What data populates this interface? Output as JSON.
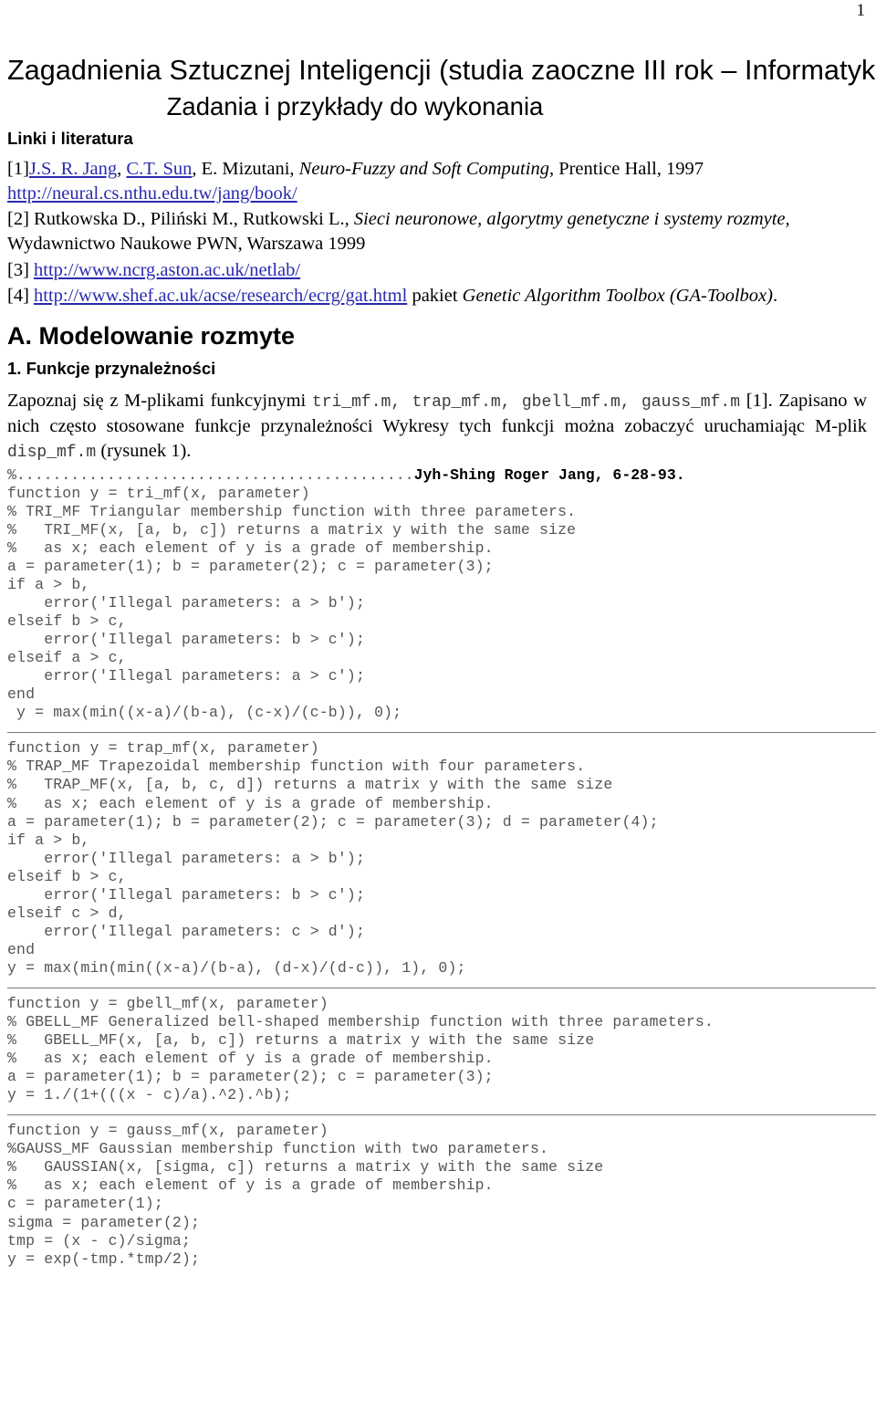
{
  "page": {
    "number": "1",
    "title": "Zagadnienia Sztucznej Inteligencji (studia zaoczne III rok – Informatyka)",
    "subtitle": "Zadania i przykłady do wykonania"
  },
  "links_section": {
    "heading": "Linki i literatura",
    "references": [
      {
        "marker": "[1]",
        "link1": "J.S. R. Jang",
        "sep1": ", ",
        "link2": "C.T. Sun",
        "rest_plain_1": ", E. Mizutani, ",
        "italic": "Neuro-Fuzzy and Soft Computing",
        "rest_plain_2": ", Prentice Hall, 1997",
        "url": "http://neural.cs.nthu.edu.tw/jang/book/"
      },
      {
        "marker": "[2]",
        "authors": " Rutkowska D., Piliński M., Rutkowski L., ",
        "italic": "Sieci neuronowe, algorytmy genetyczne i systemy rozmyte,",
        "publisher": "Wydawnictwo Naukowe PWN, Warszawa 1999"
      },
      {
        "marker": "[3]",
        "url": "http://www.ncrg.aston.ac.uk/netlab/"
      },
      {
        "marker": "[4]",
        "url": "http://www.shef.ac.uk/acse/research/ecrg/gat.html",
        "after_plain": " pakiet ",
        "after_italic": "Genetic Algorithm Toolbox (GA-Toolbox)",
        "after_tail": "."
      }
    ]
  },
  "section_a": {
    "heading": "A. Modelowanie rozmyte",
    "subsection_heading": "1. Funkcje przynależności",
    "paragraph": {
      "p1": "Zapoznaj się z M-plikami funkcyjnymi ",
      "files_mono": "tri_mf.m, trap_mf.m, gbell_mf.m, gauss_mf.m",
      "p2": " [1]. Zapisano w nich często stosowane funkcje przynależności Wykresy tych funkcji można zobaczyć uruchamiając M-plik ",
      "file_mono2": "disp_mf.m",
      "p3": " (rysunek 1)."
    },
    "attribution_line": {
      "prefix": "%............................................",
      "bold": "Jyh-Shing Roger Jang, 6-28-93."
    },
    "code_blocks": [
      {
        "name": "tri_mf",
        "code": "function y = tri_mf(x, parameter)\n% TRI_MF Triangular membership function with three parameters.\n%   TRI_MF(x, [a, b, c]) returns a matrix y with the same size\n%   as x; each element of y is a grade of membership.\na = parameter(1); b = parameter(2); c = parameter(3);\nif a > b,\n    error('Illegal parameters: a > b');\nelseif b > c,\n    error('Illegal parameters: b > c');\nelseif a > c,\n    error('Illegal parameters: a > c');\nend\n y = max(min((x-a)/(b-a), (c-x)/(c-b)), 0);"
      },
      {
        "name": "trap_mf",
        "code": "function y = trap_mf(x, parameter)\n% TRAP_MF Trapezoidal membership function with four parameters.\n%   TRAP_MF(x, [a, b, c, d]) returns a matrix y with the same size\n%   as x; each element of y is a grade of membership.\na = parameter(1); b = parameter(2); c = parameter(3); d = parameter(4);\nif a > b,\n    error('Illegal parameters: a > b');\nelseif b > c,\n    error('Illegal parameters: b > c');\nelseif c > d,\n    error('Illegal parameters: c > d');\nend\ny = max(min(min((x-a)/(b-a), (d-x)/(d-c)), 1), 0);"
      },
      {
        "name": "gbell_mf",
        "code": "function y = gbell_mf(x, parameter)\n% GBELL_MF Generalized bell-shaped membership function with three parameters.\n%   GBELL_MF(x, [a, b, c]) returns a matrix y with the same size\n%   as x; each element of y is a grade of membership.\na = parameter(1); b = parameter(2); c = parameter(3);\ny = 1./(1+(((x - c)/a).^2).^b);"
      },
      {
        "name": "gauss_mf",
        "code": "function y = gauss_mf(x, parameter)\n%GAUSS_MF Gaussian membership function with two parameters.\n%   GAUSSIAN(x, [sigma, c]) returns a matrix y with the same size\n%   as x; each element of y is a grade of membership.\nc = parameter(1);\nsigma = parameter(2);\ntmp = (x - c)/sigma;\ny = exp(-tmp.*tmp/2);"
      }
    ]
  },
  "colors": {
    "link": "#2a2ab0",
    "code_text": "#555555",
    "rule": "#7a7a7a",
    "text": "#000000"
  }
}
